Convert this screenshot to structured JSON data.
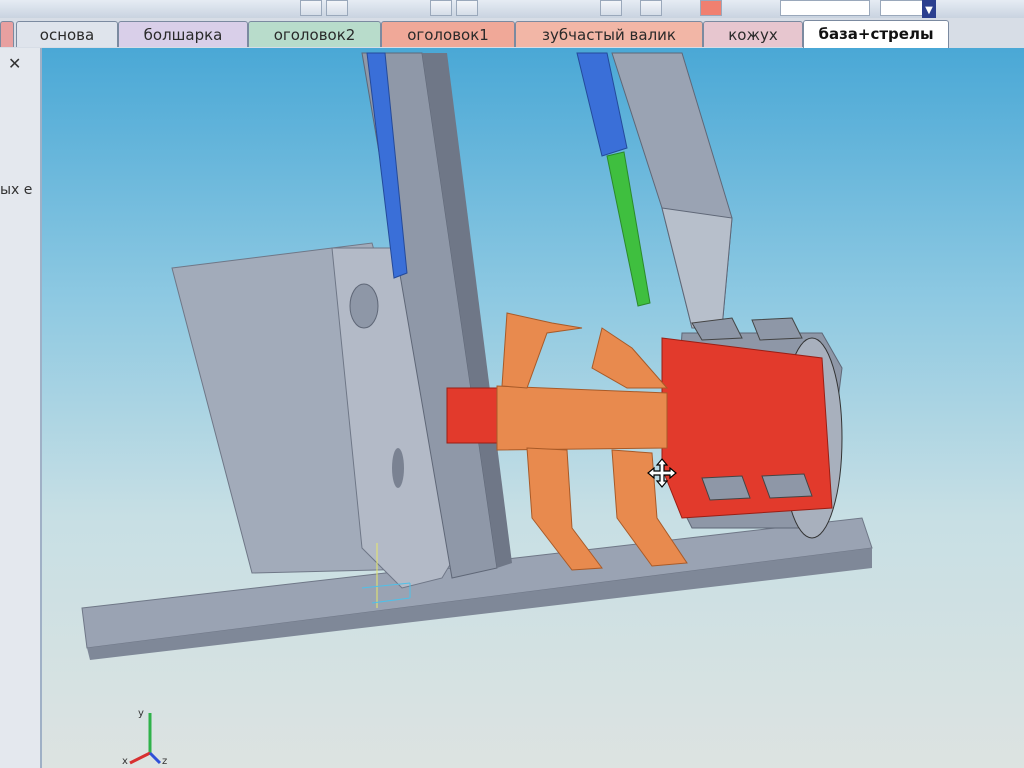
{
  "tabs": [
    {
      "label": "основа",
      "color": "#dfe4ec"
    },
    {
      "label": "болшарка",
      "color": "#d9cfe9"
    },
    {
      "label": "оголовок2",
      "color": "#b8dccb"
    },
    {
      "label": "оголовок1",
      "color": "#f0a898"
    },
    {
      "label": "зубчастый валик",
      "color": "#f2b6a6"
    },
    {
      "label": "кожух",
      "color": "#e7c6cf"
    },
    {
      "label": "база+стрелы",
      "color": "#ffffff",
      "active": true
    }
  ],
  "left_panel": {
    "partial_text": "ых е"
  },
  "viewport": {
    "axis_labels": {
      "x": "x",
      "y": "y",
      "z": "z"
    },
    "colors": {
      "frame": "#9aa3b3",
      "frame_dark": "#6f7787",
      "orange": "#e88a4e",
      "red": "#e23a2c",
      "blue": "#3a6fd8",
      "green": "#3fbf3f"
    }
  }
}
